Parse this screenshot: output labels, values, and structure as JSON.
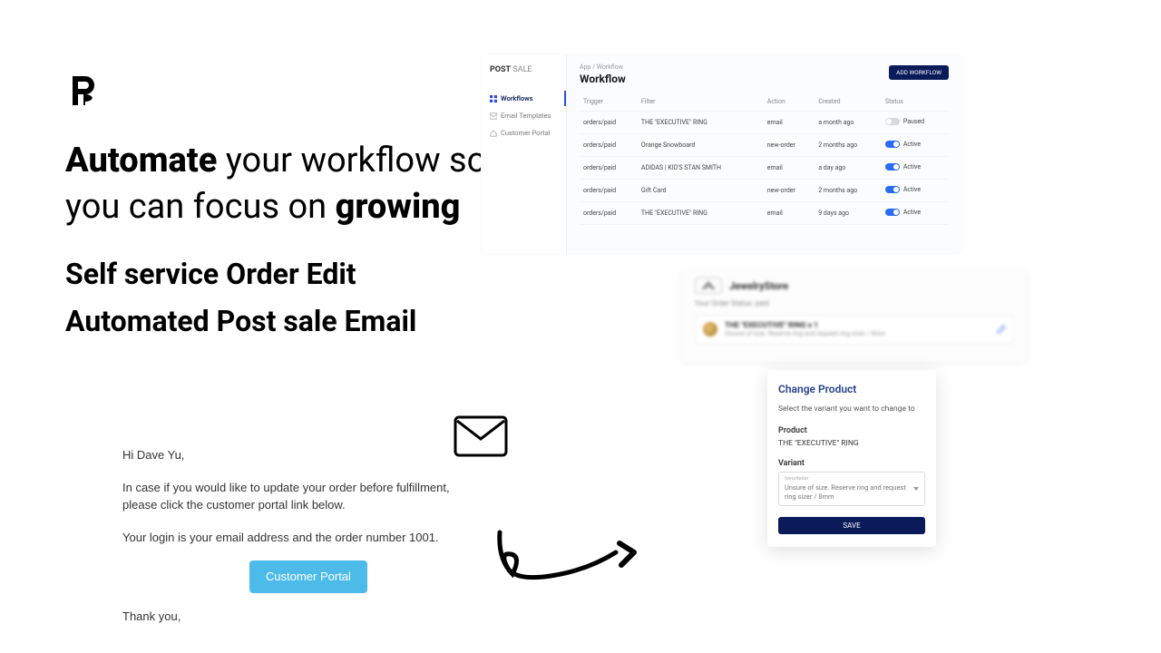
{
  "left": {
    "tagline_b1": "Automate",
    "tagline_mid": " your workflow so you can focus on ",
    "tagline_b2": "growing",
    "sub1": "Self service Order Edit",
    "sub2": "Automated Post sale Email"
  },
  "email": {
    "greeting": "Hi Dave Yu,",
    "body1": "In case if you would like to update your order before fulfillment, please click the customer portal link below.",
    "body2": "Your login is your email address and the order number 1001.",
    "button": "Customer Portal",
    "closing": "Thank you,"
  },
  "app": {
    "brand_a": "POST",
    "brand_b": " SALE",
    "nav": {
      "workflows": "Workflows",
      "email_templates": "Email Templates",
      "customer_portal": "Customer Portal"
    },
    "breadcrumb": "App / Workflow",
    "title": "Workflow",
    "add_btn": "ADD WORKFLOW",
    "columns": {
      "trigger": "Trigger",
      "filter": "Filter",
      "action": "Action",
      "created": "Created",
      "status": "Status"
    },
    "rows": [
      {
        "trigger": "orders/paid",
        "filter": "THE \"EXECUTIVE\" RING",
        "action": "email",
        "created": "a month ago",
        "status": "Paused",
        "on": false
      },
      {
        "trigger": "orders/paid",
        "filter": "Orange Snowboard",
        "action": "new-order",
        "created": "2 months ago",
        "status": "Active",
        "on": true
      },
      {
        "trigger": "orders/paid",
        "filter": "ADIDAS | KID'S STAN SMITH",
        "action": "email",
        "created": "a day ago",
        "status": "Active",
        "on": true
      },
      {
        "trigger": "orders/paid",
        "filter": "Gift Card",
        "action": "new-order",
        "created": "2 months ago",
        "status": "Active",
        "on": true
      },
      {
        "trigger": "orders/paid",
        "filter": "THE \"EXECUTIVE\" RING",
        "action": "email",
        "created": "9 days ago",
        "status": "Active",
        "on": true
      }
    ]
  },
  "order_card": {
    "store": "JewelryStore",
    "status_line": "Your Order Status: paid",
    "item_title": "THE \"EXECUTIVE\" RING x 1",
    "item_sub": "Unsure of size. Reserve ring and request ring sizer / 8mm"
  },
  "change": {
    "title": "Change Product",
    "sub": "Select the variant you want to change to",
    "product_label": "Product",
    "product_val": "THE \"EXECUTIVE\" RING",
    "variant_label": "Variant",
    "variant_small": "favoritedar",
    "variant_val": "Unsure of size. Reserve ring and request ring sizer / 8mm",
    "save": "SAVE"
  },
  "colors": {
    "navy": "#0b1b59",
    "blue": "#2a6df4",
    "cyan": "#4dbbea"
  }
}
